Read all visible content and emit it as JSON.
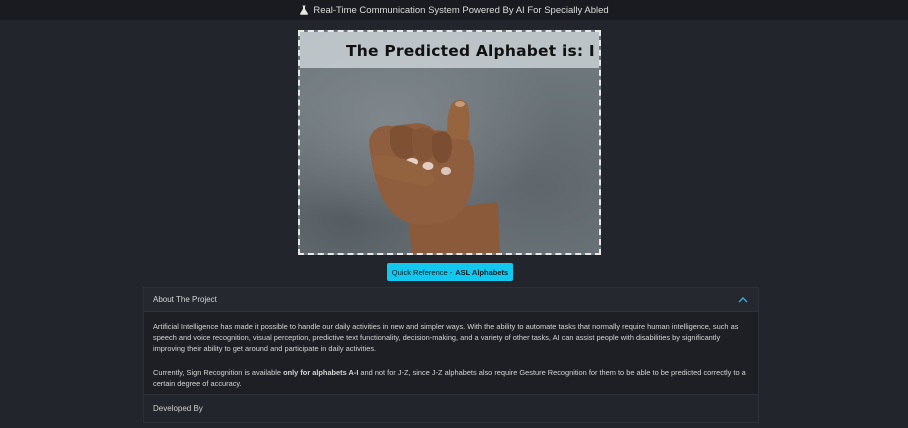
{
  "header": {
    "title": "Real-Time Communication System Powered By AI For Specially Abled",
    "icon": "flask-icon"
  },
  "video": {
    "overlay_text": "The Predicted Alphabet is: I",
    "predicted_letter": "I"
  },
  "reference_button": {
    "label_prefix": "Quick Reference -",
    "label_bold": "ASL Alphabets"
  },
  "about": {
    "title": "About The Project",
    "expanded": true,
    "paragraph1": "Artificial Intelligence has made it possible to handle our daily activities in new and simpler ways. With the ability to automate tasks that normally require human intelligence, such as speech and voice recognition, visual perception, predictive text functionality, decision-making, and a variety of other tasks, AI can assist people with disabilities by significantly improving their ability to get around and participate in daily activities.",
    "paragraph2_before": "Currently, Sign Recognition is available ",
    "paragraph2_bold": "only for alphabets A-I",
    "paragraph2_after": " and not for J-Z, since J-Z alphabets also require Gesture Recognition for them to be able to be predicted correctly to a certain degree of accuracy."
  },
  "developed_by": {
    "title": "Developed By"
  },
  "colors": {
    "background": "#23252c",
    "topbar": "#1a1b20",
    "accent_button": "#13c8ee",
    "chevron": "#3fa9d8"
  }
}
